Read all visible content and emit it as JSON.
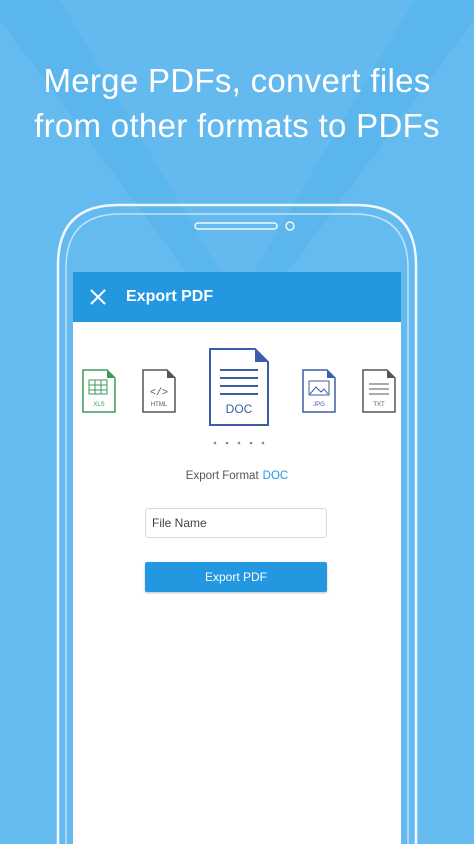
{
  "promo": {
    "line1": "Merge PDFs, convert files",
    "line2": "from other formats to PDFs"
  },
  "appbar": {
    "title": "Export PDF"
  },
  "formats": {
    "items": [
      "XLS",
      "HTML",
      "DOC",
      "JPG",
      "TXT"
    ],
    "selected": "DOC"
  },
  "export": {
    "label": "Export Format",
    "value": "DOC",
    "file_placeholder": "File Name",
    "button_label": "Export PDF"
  },
  "colors": {
    "background": "#5cb6ee",
    "accent": "#2398e0",
    "doc_blue": "#3b5ea8",
    "xls_green": "#3d9a5a"
  }
}
